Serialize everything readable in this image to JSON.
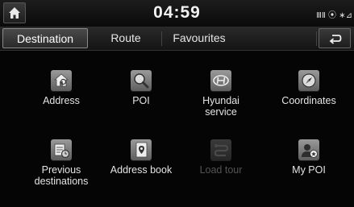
{
  "status": {
    "time": "04:59",
    "indicators": "ⅢⅡ ⦿ ∗⊿"
  },
  "tabs": [
    {
      "label": "Destination",
      "active": true
    },
    {
      "label": "Route",
      "active": false
    },
    {
      "label": "Favourites",
      "active": false
    }
  ],
  "icons": {
    "home": "home-icon",
    "back": "back-arrow-icon"
  },
  "menu": {
    "address": {
      "label": "Address",
      "icon": "house-icon",
      "enabled": true
    },
    "poi": {
      "label": "POI",
      "icon": "magnifier-icon",
      "enabled": true
    },
    "hyundai_service": {
      "label": "Hyundai\nservice",
      "icon": "hyundai-logo-icon",
      "enabled": true
    },
    "coordinates": {
      "label": "Coordinates",
      "icon": "compass-icon",
      "enabled": true
    },
    "previous_destinations": {
      "label": "Previous\ndestinations",
      "icon": "history-folder-icon",
      "enabled": true
    },
    "address_book": {
      "label": "Address book",
      "icon": "address-book-icon",
      "enabled": true
    },
    "load_tour": {
      "label": "Load tour",
      "icon": "tour-route-icon",
      "enabled": false
    },
    "my_poi": {
      "label": "My POI",
      "icon": "user-star-icon",
      "enabled": true
    }
  },
  "colors": {
    "background": "#050505",
    "icon_fill": "#7a7a7a",
    "disabled_text": "#555555"
  }
}
